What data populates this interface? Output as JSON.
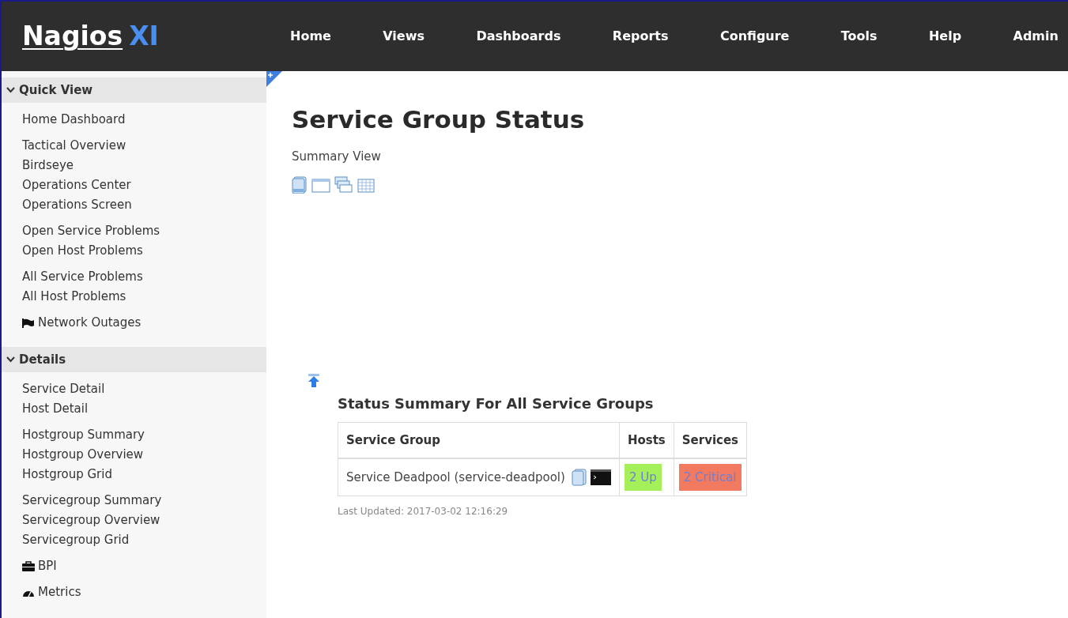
{
  "logo": {
    "name": "Nagios",
    "suffix": "XI"
  },
  "nav": [
    "Home",
    "Views",
    "Dashboards",
    "Reports",
    "Configure",
    "Tools",
    "Help",
    "Admin"
  ],
  "sidebar": [
    {
      "title": "Quick View",
      "expanded": true,
      "groups": [
        [
          "Home Dashboard"
        ],
        [
          "Tactical Overview",
          "Birdseye",
          "Operations Center",
          "Operations Screen"
        ],
        [
          "Open Service Problems",
          "Open Host Problems"
        ],
        [
          "All Service Problems",
          "All Host Problems"
        ],
        [
          {
            "label": "Network Outages",
            "kind": "flag"
          }
        ]
      ]
    },
    {
      "title": "Details",
      "expanded": true,
      "groups": [
        [
          "Service Detail",
          "Host Detail"
        ],
        [
          "Hostgroup Summary",
          "Hostgroup Overview",
          "Hostgroup Grid"
        ],
        [
          "Servicegroup Summary",
          "Servicegroup Overview",
          "Servicegroup Grid"
        ],
        [
          {
            "label": "BPI",
            "kind": "briefcase"
          }
        ],
        [
          {
            "label": "Metrics",
            "kind": "gauge"
          }
        ]
      ]
    }
  ],
  "page": {
    "title": "Service Group Status",
    "subtitle": "Summary View"
  },
  "summary": {
    "title": "Status Summary For All Service Groups",
    "columns": [
      "Service Group",
      "Hosts",
      "Services"
    ],
    "rows": [
      {
        "group": "Service Deadpool (service-deadpool)",
        "hosts": {
          "text": "2 Up",
          "color": "#a5f05a"
        },
        "services": {
          "text": "2 Critical",
          "color": "#f27a60"
        }
      }
    ],
    "updated": "Last Updated: 2017-03-02 12:16:29"
  }
}
